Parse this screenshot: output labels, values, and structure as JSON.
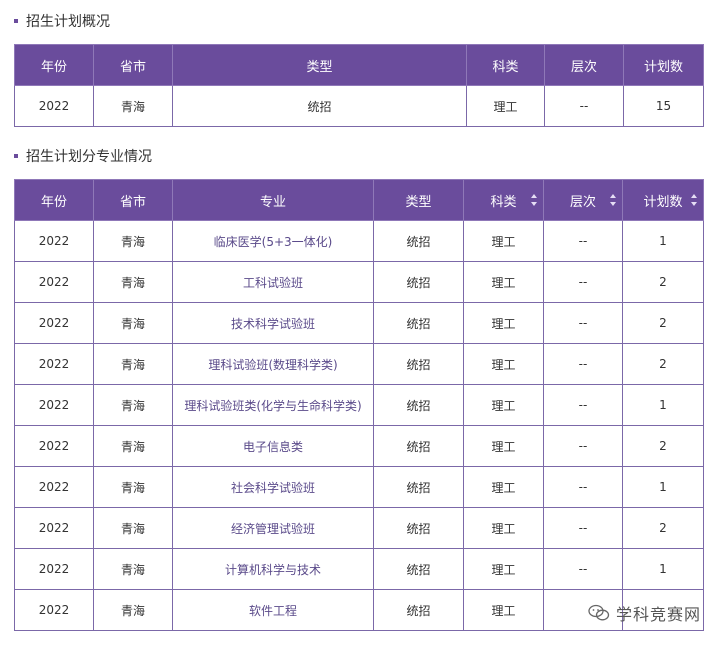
{
  "overview": {
    "title": "招生计划概况",
    "headers": [
      "年份",
      "省市",
      "类型",
      "科类",
      "层次",
      "计划数"
    ],
    "row": {
      "year": "2022",
      "province": "青海",
      "type": "统招",
      "category": "理工",
      "level": "--",
      "count": "15"
    }
  },
  "by_major": {
    "title": "招生计划分专业情况",
    "headers": [
      "年份",
      "省市",
      "专业",
      "类型",
      "科类",
      "层次",
      "计划数"
    ],
    "rows": [
      {
        "year": "2022",
        "province": "青海",
        "major": "临床医学(5+3一体化)",
        "type": "统招",
        "category": "理工",
        "level": "--",
        "count": "1"
      },
      {
        "year": "2022",
        "province": "青海",
        "major": "工科试验班",
        "type": "统招",
        "category": "理工",
        "level": "--",
        "count": "2"
      },
      {
        "year": "2022",
        "province": "青海",
        "major": "技术科学试验班",
        "type": "统招",
        "category": "理工",
        "level": "--",
        "count": "2"
      },
      {
        "year": "2022",
        "province": "青海",
        "major": "理科试验班(数理科学类)",
        "type": "统招",
        "category": "理工",
        "level": "--",
        "count": "2"
      },
      {
        "year": "2022",
        "province": "青海",
        "major": "理科试验班类(化学与生命科学类)",
        "type": "统招",
        "category": "理工",
        "level": "--",
        "count": "1"
      },
      {
        "year": "2022",
        "province": "青海",
        "major": "电子信息类",
        "type": "统招",
        "category": "理工",
        "level": "--",
        "count": "2"
      },
      {
        "year": "2022",
        "province": "青海",
        "major": "社会科学试验班",
        "type": "统招",
        "category": "理工",
        "level": "--",
        "count": "1"
      },
      {
        "year": "2022",
        "province": "青海",
        "major": "经济管理试验班",
        "type": "统招",
        "category": "理工",
        "level": "--",
        "count": "2"
      },
      {
        "year": "2022",
        "province": "青海",
        "major": "计算机科学与技术",
        "type": "统招",
        "category": "理工",
        "level": "--",
        "count": "1"
      },
      {
        "year": "2022",
        "province": "青海",
        "major": "软件工程",
        "type": "统招",
        "category": "理工",
        "level": "",
        "count": ""
      }
    ]
  },
  "watermark": {
    "text": "学科竞赛网",
    "icon": "wechat-icon"
  }
}
